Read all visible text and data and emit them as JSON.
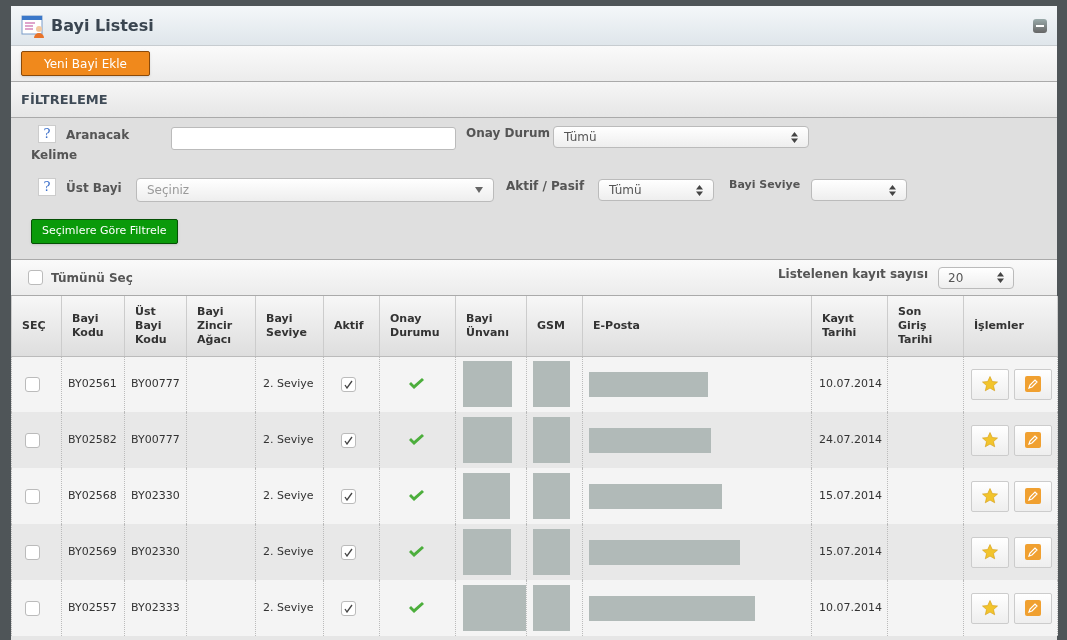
{
  "window": {
    "title": "Bayi Listesi"
  },
  "toolbar": {
    "add_button": "Yeni Bayi Ekle"
  },
  "filter": {
    "title": "FİLTRELEME",
    "keyword": {
      "help": "?",
      "label_1": "Aranacak",
      "label_2": "Kelime"
    },
    "approval": {
      "label": "Onay Durum",
      "value": "Tümü"
    },
    "parent": {
      "help": "?",
      "label": "Üst Bayi",
      "placeholder": "Seçiniz"
    },
    "active": {
      "label": "Aktif / Pasif",
      "value": "Tümü"
    },
    "level": {
      "label": "Bayi Seviye"
    },
    "apply_button": "Seçimlere Göre Filtrele"
  },
  "list_bar": {
    "select_all": {
      "label": "Tümünü Seç",
      "checked": false
    },
    "count_label": "Listelenen kayıt sayısı",
    "page_size": "20"
  },
  "table": {
    "columns": [
      "SEÇ",
      "Bayi Kodu",
      "Üst Bayi Kodu",
      "Bayi Zincir Ağacı",
      "Bayi Seviye",
      "Aktif",
      "Onay Durumu",
      "Bayi Ünvanı",
      "GSM",
      "E-Posta",
      "Kayıt Tarihi",
      "Son Giriş Tarihi",
      "İşlemler"
    ],
    "rows": [
      {
        "selected": false,
        "code": "BY02561",
        "parent_code": "BY00777",
        "level": "2. Seviye",
        "active": true,
        "approved": true,
        "registered": "10.07.2014"
      },
      {
        "selected": false,
        "code": "BY02582",
        "parent_code": "BY00777",
        "level": "2. Seviye",
        "active": true,
        "approved": true,
        "registered": "24.07.2014"
      },
      {
        "selected": false,
        "code": "BY02568",
        "parent_code": "BY02330",
        "level": "2. Seviye",
        "active": true,
        "approved": true,
        "registered": "15.07.2014"
      },
      {
        "selected": false,
        "code": "BY02569",
        "parent_code": "BY02330",
        "level": "2. Seviye",
        "active": true,
        "approved": true,
        "registered": "15.07.2014"
      },
      {
        "selected": false,
        "code": "BY02557",
        "parent_code": "BY02333",
        "level": "2. Seviye",
        "active": true,
        "approved": true,
        "registered": "10.07.2014"
      }
    ]
  }
}
